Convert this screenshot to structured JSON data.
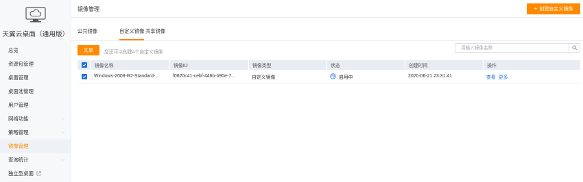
{
  "sidebar": {
    "logo_title": "天翼云桌面（通用版）",
    "items": [
      {
        "label": "总览",
        "has_chevron": false,
        "external": false,
        "active": false
      },
      {
        "label": "资源包管理",
        "has_chevron": false,
        "external": false,
        "active": false
      },
      {
        "label": "桌面管理",
        "has_chevron": false,
        "external": false,
        "active": false
      },
      {
        "label": "桌面池管理",
        "has_chevron": false,
        "external": false,
        "active": false
      },
      {
        "label": "用户管理",
        "has_chevron": false,
        "external": false,
        "active": false
      },
      {
        "label": "网络功能",
        "has_chevron": true,
        "external": false,
        "active": false
      },
      {
        "label": "策略管理",
        "has_chevron": true,
        "external": false,
        "active": false
      },
      {
        "label": "镜像管理",
        "has_chevron": false,
        "external": false,
        "active": true
      },
      {
        "label": "查询统计",
        "has_chevron": true,
        "external": false,
        "active": false
      },
      {
        "label": "独立型桌面",
        "has_chevron": false,
        "external": true,
        "active": false
      }
    ]
  },
  "header": {
    "title": "镜像管理",
    "create_button": "创建自定义镜像"
  },
  "tabs": [
    {
      "label": "公共镜像",
      "active": false
    },
    {
      "label": "自定义镜像",
      "active": true
    },
    {
      "label": "共享镜像",
      "active": false
    }
  ],
  "toolbar": {
    "share_button": "共享",
    "hint": "您还可以创建4个自定义镜像",
    "search_placeholder": "请输入镜像名称"
  },
  "table": {
    "columns": [
      "镜像名称",
      "镜像ID",
      "镜像类型",
      "状态",
      "创建时间",
      "操作"
    ],
    "rows": [
      {
        "name": "Windows-2008-R2-Standard-...",
        "id": "f0620c41-cebf-446b-b90e-7...",
        "type": "自定义镜像",
        "status": "启用中",
        "created": "2020-06-21 23:31:41",
        "actions": [
          "查看",
          "更多"
        ]
      }
    ]
  },
  "colors": {
    "accent": "#ff8a00",
    "link": "#1e6fd9",
    "table_header_bg": "#e8edf4"
  }
}
